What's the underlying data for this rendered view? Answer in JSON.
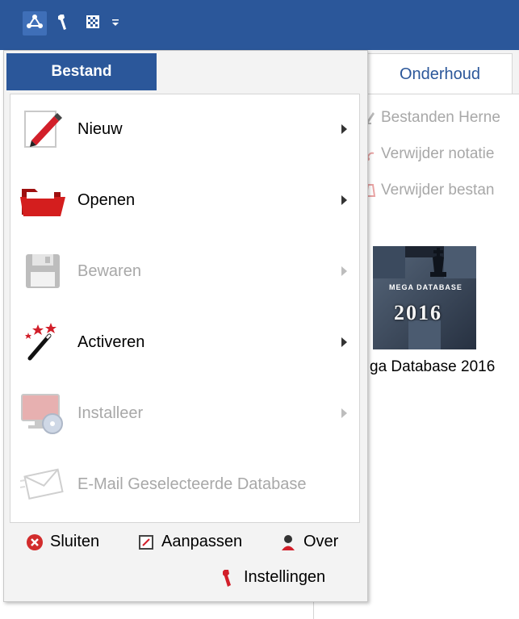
{
  "titlebar": {
    "qat_icons": [
      "network-icon",
      "wrench-icon",
      "grid-icon",
      "customize-dropdown-icon"
    ]
  },
  "ribbon": {
    "tab_label": "Onderhoud",
    "items": [
      {
        "label": "Bestanden Herne",
        "icon": "rename-icon"
      },
      {
        "label": "Verwijder notatie",
        "icon": "delete-notation-icon"
      },
      {
        "label": "Verwijder bestan",
        "icon": "delete-file-icon"
      }
    ]
  },
  "database": {
    "thumb_title": "MEGA DATABASE",
    "thumb_year": "2016",
    "caption": "ga Database 2016"
  },
  "menu": {
    "tab_label": "Bestand",
    "items": [
      {
        "label": "Nieuw",
        "enabled": true,
        "icon": "new-pencil-icon"
      },
      {
        "label": "Openen",
        "enabled": true,
        "icon": "folder-icon"
      },
      {
        "label": "Bewaren",
        "enabled": false,
        "icon": "floppy-icon"
      },
      {
        "label": "Activeren",
        "enabled": true,
        "icon": "magic-wand-icon"
      },
      {
        "label": "Installeer",
        "enabled": false,
        "icon": "install-cd-icon"
      },
      {
        "label": "E-Mail Geselecteerde Database",
        "enabled": false,
        "icon": "email-icon"
      }
    ],
    "footer": {
      "close_label": "Sluiten",
      "customize_label": "Aanpassen",
      "about_label": "Over",
      "settings_label": "Instellingen"
    }
  },
  "colors": {
    "accent": "#2b579a",
    "disabled_text": "#a8a8a8",
    "close_red": "#d22c2c"
  }
}
